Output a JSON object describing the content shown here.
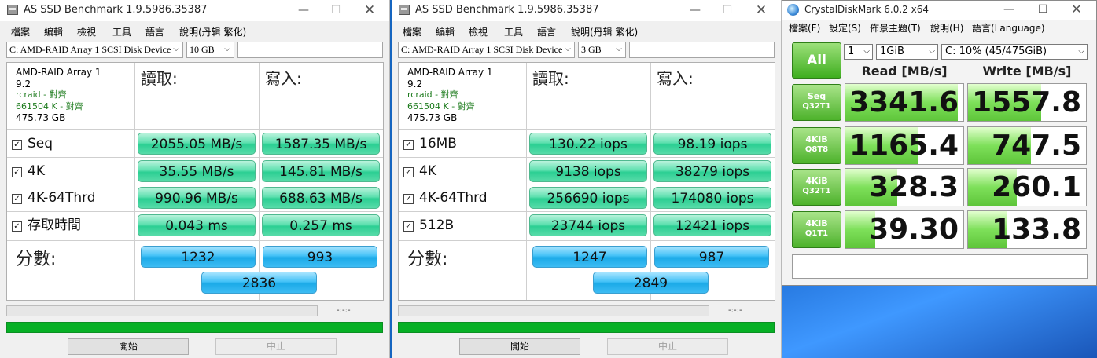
{
  "asssd_windows": [
    {
      "title": "AS SSD Benchmark 1.9.5986.35387",
      "menu": [
        "檔案",
        "編輯",
        "檢視",
        "工具",
        "語言",
        "說明(丹辑 繁化)"
      ],
      "drive_select": "C: AMD-RAID Array 1  SCSI Disk Device",
      "size_select": "10 GB",
      "drive_info": {
        "name": "AMD-RAID Array 1",
        "version": "9.2",
        "driver": "rcraid - 對齊",
        "alignment": "661504 K - 對齊",
        "capacity": "475.73 GB"
      },
      "read_header": "讀取:",
      "write_header": "寫入:",
      "rows": [
        {
          "label": "Seq",
          "read": "2055.05 MB/s",
          "write": "1587.35 MB/s"
        },
        {
          "label": "4K",
          "read": "35.55 MB/s",
          "write": "145.81 MB/s"
        },
        {
          "label": "4K-64Thrd",
          "read": "990.96 MB/s",
          "write": "688.63 MB/s"
        },
        {
          "label": "存取時間",
          "read": "0.043 ms",
          "write": "0.257 ms"
        }
      ],
      "score_label": "分數:",
      "score_read": "1232",
      "score_write": "993",
      "score_total": "2836",
      "time": "-:-:-",
      "start_button": "開始",
      "stop_button": "中止"
    },
    {
      "title": "AS SSD Benchmark 1.9.5986.35387",
      "menu": [
        "檔案",
        "編輯",
        "檢視",
        "工具",
        "語言",
        "說明(丹辑 繁化)"
      ],
      "drive_select": "C: AMD-RAID Array 1  SCSI Disk Device",
      "size_select": "3 GB",
      "drive_info": {
        "name": "AMD-RAID Array 1",
        "version": "9.2",
        "driver": "rcraid - 對齊",
        "alignment": "661504 K - 對齊",
        "capacity": "475.73 GB"
      },
      "read_header": "讀取:",
      "write_header": "寫入:",
      "rows": [
        {
          "label": "16MB",
          "read": "130.22 iops",
          "write": "98.19 iops"
        },
        {
          "label": "4K",
          "read": "9138 iops",
          "write": "38279 iops"
        },
        {
          "label": "4K-64Thrd",
          "read": "256690 iops",
          "write": "174080 iops"
        },
        {
          "label": "512B",
          "read": "23744 iops",
          "write": "12421 iops"
        }
      ],
      "score_label": "分數:",
      "score_read": "1247",
      "score_write": "987",
      "score_total": "2849",
      "time": "-:-:-",
      "start_button": "開始",
      "stop_button": "中止"
    }
  ],
  "cdm": {
    "title": "CrystalDiskMark 6.0.2 x64",
    "menu": [
      "檔案(F)",
      "設定(S)",
      "佈景主題(T)",
      "說明(H)",
      "語言(Language)"
    ],
    "all_button": "All",
    "count_select": "1",
    "size_select": "1GiB",
    "drive_select": "C: 10% (45/475GiB)",
    "read_header": "Read [MB/s]",
    "write_header": "Write [MB/s]",
    "tests": [
      {
        "line1": "Seq",
        "line2": "Q32T1",
        "read": "3341.6",
        "write": "1557.8",
        "read_fill": 0.95,
        "write_fill": 0.62
      },
      {
        "line1": "4KiB",
        "line2": "Q8T8",
        "read": "1165.4",
        "write": "747.5",
        "read_fill": 0.62,
        "write_fill": 0.53
      },
      {
        "line1": "4KiB",
        "line2": "Q32T1",
        "read": "328.3",
        "write": "260.1",
        "read_fill": 0.44,
        "write_fill": 0.41
      },
      {
        "line1": "4KiB",
        "line2": "Q1T1",
        "read": "39.30",
        "write": "133.8",
        "read_fill": 0.25,
        "write_fill": 0.33
      }
    ]
  }
}
